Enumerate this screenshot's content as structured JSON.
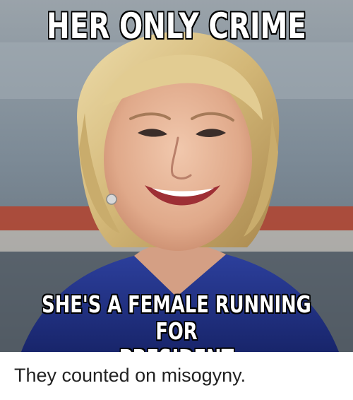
{
  "meme": {
    "top_caption": "HER ONLY CRIME",
    "bottom_caption_line1": "SHE'S A FEMALE RUNNING FOR",
    "bottom_caption_line2": "PRESIDENT"
  },
  "post": {
    "text": "They counted on misogyny."
  },
  "colors": {
    "caption_fill": "#ffffff",
    "caption_outline": "#000000",
    "jacket": "#22338a",
    "hair": "#d9c187",
    "background_wall": "#8f9aa4",
    "red_stripe": "#b4432e",
    "post_text": "#222222"
  }
}
